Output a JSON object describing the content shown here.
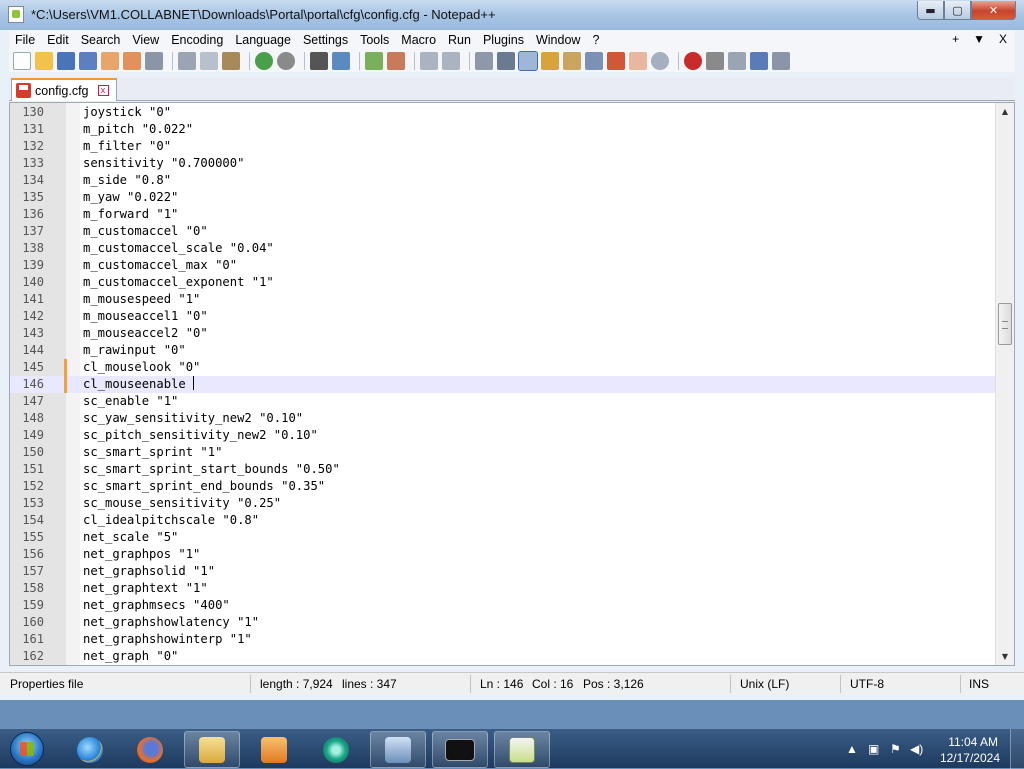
{
  "window": {
    "title": "*C:\\Users\\VM1.COLLABNET\\Downloads\\Portal\\portal\\cfg\\config.cfg - Notepad++",
    "controls": {
      "minimize": "▬",
      "maximize": "▢",
      "close": "✕"
    }
  },
  "menu": {
    "items": [
      "File",
      "Edit",
      "Search",
      "View",
      "Encoding",
      "Language",
      "Settings",
      "Tools",
      "Macro",
      "Run",
      "Plugins",
      "Window",
      "?"
    ],
    "right": {
      "add": "+",
      "dropdown": "▼",
      "close": "X"
    }
  },
  "tab": {
    "label": "config.cfg",
    "close": "x"
  },
  "editor": {
    "current_line": 146,
    "lines": [
      {
        "n": "130",
        "text": "joystick \"0\""
      },
      {
        "n": "131",
        "text": "m_pitch \"0.022\""
      },
      {
        "n": "132",
        "text": "m_filter \"0\""
      },
      {
        "n": "133",
        "text": "sensitivity \"0.700000\""
      },
      {
        "n": "134",
        "text": "m_side \"0.8\""
      },
      {
        "n": "135",
        "text": "m_yaw \"0.022\""
      },
      {
        "n": "136",
        "text": "m_forward \"1\""
      },
      {
        "n": "137",
        "text": "m_customaccel \"0\""
      },
      {
        "n": "138",
        "text": "m_customaccel_scale \"0.04\""
      },
      {
        "n": "139",
        "text": "m_customaccel_max \"0\""
      },
      {
        "n": "140",
        "text": "m_customaccel_exponent \"1\""
      },
      {
        "n": "141",
        "text": "m_mousespeed \"1\""
      },
      {
        "n": "142",
        "text": "m_mouseaccel1 \"0\""
      },
      {
        "n": "143",
        "text": "m_mouseaccel2 \"0\""
      },
      {
        "n": "144",
        "text": "m_rawinput \"0\""
      },
      {
        "n": "145",
        "text": "cl_mouselook \"0\""
      },
      {
        "n": "146",
        "text": "cl_mouseenable "
      },
      {
        "n": "147",
        "text": "sc_enable \"1\""
      },
      {
        "n": "148",
        "text": "sc_yaw_sensitivity_new2 \"0.10\""
      },
      {
        "n": "149",
        "text": "sc_pitch_sensitivity_new2 \"0.10\""
      },
      {
        "n": "150",
        "text": "sc_smart_sprint \"1\""
      },
      {
        "n": "151",
        "text": "sc_smart_sprint_start_bounds \"0.50\""
      },
      {
        "n": "152",
        "text": "sc_smart_sprint_end_bounds \"0.35\""
      },
      {
        "n": "153",
        "text": "sc_mouse_sensitivity \"0.25\""
      },
      {
        "n": "154",
        "text": "cl_idealpitchscale \"0.8\""
      },
      {
        "n": "155",
        "text": "net_scale \"5\""
      },
      {
        "n": "156",
        "text": "net_graphpos \"1\""
      },
      {
        "n": "157",
        "text": "net_graphsolid \"1\""
      },
      {
        "n": "158",
        "text": "net_graphtext \"1\""
      },
      {
        "n": "159",
        "text": "net_graphmsecs \"400\""
      },
      {
        "n": "160",
        "text": "net_graphshowlatency \"1\""
      },
      {
        "n": "161",
        "text": "net_graphshowinterp \"1\""
      },
      {
        "n": "162",
        "text": "net_graph \"0\""
      }
    ],
    "modified_lines": [
      "145",
      "146"
    ]
  },
  "status": {
    "file_type": "Properties file",
    "length": "length : 7,924",
    "lines": "lines : 347",
    "ln": "Ln : 146",
    "col": "Col : 16",
    "pos": "Pos : 3,126",
    "eol": "Unix (LF)",
    "encoding": "UTF-8",
    "mode": "INS"
  },
  "taskbar": {
    "apps": [
      "start-orb",
      "internet-explorer",
      "firefox",
      "file-explorer",
      "media-player",
      "app-circle",
      "network-app",
      "command-prompt",
      "notepad-plus-plus"
    ],
    "clock_time": "11:04 AM",
    "clock_date": "12/17/2024"
  },
  "colors": {
    "accent_tab": "#f59a24",
    "current_line_bg": "#e8e8ff",
    "gutter_bg": "#e4e4e4"
  }
}
